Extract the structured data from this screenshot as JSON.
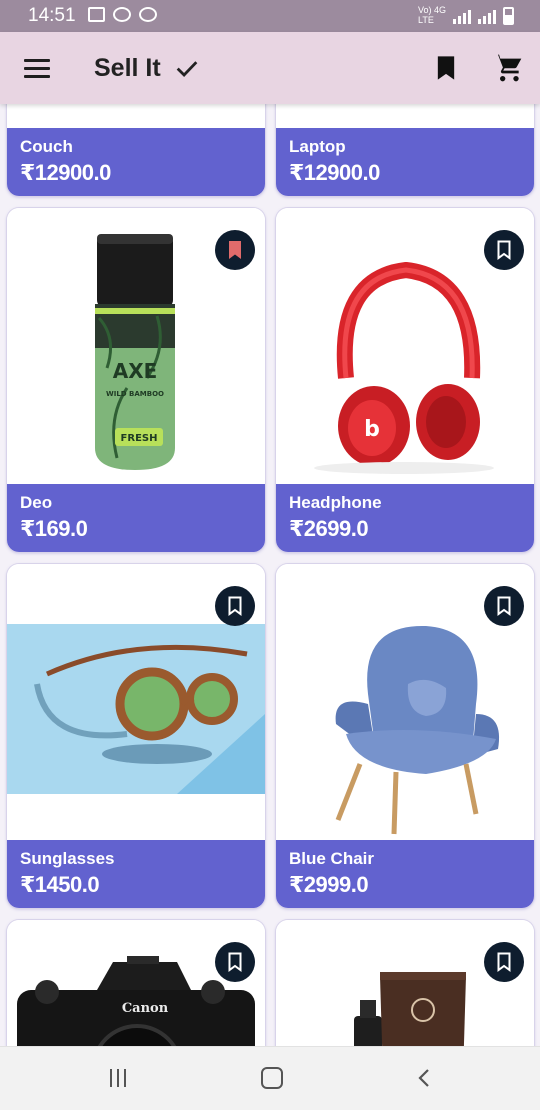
{
  "status_bar": {
    "time": "14:51",
    "left_icons": [
      "gallery-icon",
      "link-icon",
      "wifi-icon"
    ],
    "network_label_top": "Vo) 4G",
    "network_label_bottom": "LTE",
    "right_icons": [
      "signal-icon",
      "signal-icon",
      "battery-icon"
    ]
  },
  "app_bar": {
    "title": "Sell It",
    "icons": [
      "menu-icon",
      "check-icon",
      "bookmark-icon",
      "cart-icon"
    ]
  },
  "products": [
    {
      "name": "Couch",
      "price": "₹12900.0",
      "bookmarked": false,
      "bookmark_visible": false
    },
    {
      "name": "Laptop",
      "price": "₹12900.0",
      "bookmarked": false,
      "bookmark_visible": false
    },
    {
      "name": "Deo",
      "price": "₹169.0",
      "bookmarked": true,
      "bookmark_visible": true,
      "image": "axe-deodorant-can"
    },
    {
      "name": "Headphone",
      "price": "₹2699.0",
      "bookmarked": false,
      "bookmark_visible": true,
      "image": "red-headphones"
    },
    {
      "name": "Sunglasses",
      "price": "₹1450.0",
      "bookmarked": false,
      "bookmark_visible": true,
      "image": "round-sunglasses"
    },
    {
      "name": "Blue Chair",
      "price": "₹2999.0",
      "bookmarked": false,
      "bookmark_visible": true,
      "image": "blue-armchair"
    },
    {
      "name": "",
      "price": "",
      "bookmarked": false,
      "bookmark_visible": true,
      "image": "camera"
    },
    {
      "name": "",
      "price": "",
      "bookmarked": false,
      "bookmark_visible": true,
      "image": "cream-tube"
    }
  ],
  "image_text": {
    "deo_brand": "AXE",
    "deo_variant": "WILD BAMBOO",
    "deo_fresh": "FRESH",
    "camera_brand": "Canon"
  },
  "colors": {
    "app_bar": "#e8d5e2",
    "status_bar": "#9c8b9e",
    "card_info": "#6262cf",
    "bookmark_button": "#0e1d2e",
    "bookmark_active": "#e06b6b"
  },
  "nav_bar": {
    "icons": [
      "recents-icon",
      "home-icon",
      "back-icon"
    ]
  }
}
